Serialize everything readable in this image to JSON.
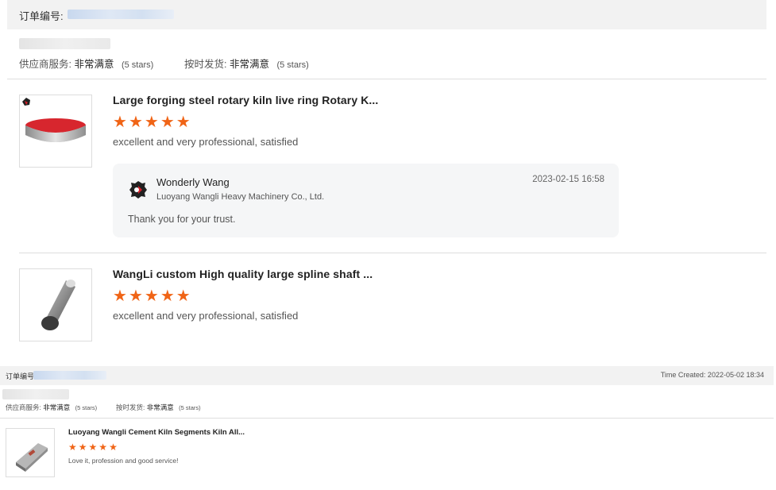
{
  "order1": {
    "order_no_label": "订单编号:",
    "supplier_service_label": "供应商服务:",
    "supplier_service_value": "非常满意",
    "supplier_service_stars": "(5 stars)",
    "shipping_label": "按时发货:",
    "shipping_value": "非常满意",
    "shipping_stars": "(5 stars)",
    "items": [
      {
        "title": "Large forging steel rotary kiln live ring Rotary K...",
        "rating": 5,
        "review": "excellent and very professional, satisfied",
        "reply": {
          "name": "Wonderly Wang",
          "company": "Luoyang Wangli Heavy Machinery Co., Ltd.",
          "date": "2023-02-15 16:58",
          "message": "Thank you for your trust."
        }
      },
      {
        "title": "WangLi custom High quality large spline shaft ...",
        "rating": 5,
        "review": "excellent and very professional, satisfied"
      }
    ]
  },
  "order2": {
    "order_no_label": "订单编号",
    "time_created": "Time Created: 2022-05-02 18:34",
    "supplier_service_label": "供应商服务:",
    "supplier_service_value": "非常满意",
    "supplier_service_stars": "(5 stars)",
    "shipping_label": "按时发货:",
    "shipping_value": "非常满意",
    "shipping_stars": "(5 stars)",
    "items": [
      {
        "title": "Luoyang Wangli Cement Kiln Segments Kiln All...",
        "rating": 5,
        "review": "Love it, profession and good service!"
      }
    ]
  },
  "colors": {
    "star": "#f06416",
    "header_bg": "#f2f2f2",
    "reply_bg": "#f5f6f7"
  },
  "icons": [
    "star-icon",
    "company-logo-icon"
  ]
}
